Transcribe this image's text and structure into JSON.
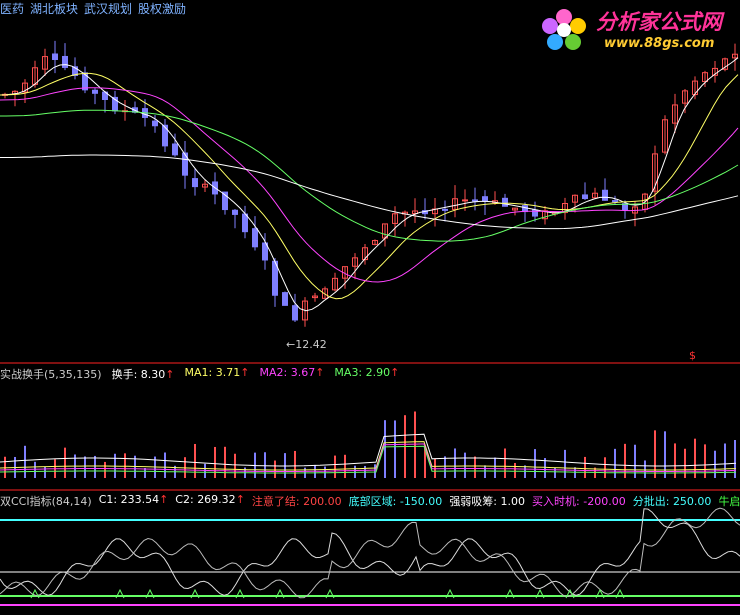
{
  "header": {
    "tags": [
      "医药",
      "湖北板块",
      "武汉规划",
      "股权激励"
    ],
    "tags_color": "#7fb2ff"
  },
  "watermark": {
    "site_name": "分析家公式网",
    "url": "www.88gs.com"
  },
  "price_panel": {
    "low_label": "12.42",
    "marker_symbol": "$"
  },
  "volume_panel": {
    "title": "实战换手(5,35,135)",
    "items": [
      {
        "label": "换手:",
        "value": "8.30",
        "arrow": "↑",
        "color": "#ffffff"
      },
      {
        "label": "MA1:",
        "value": "3.71",
        "arrow": "↑",
        "color": "#ffff66"
      },
      {
        "label": "MA2:",
        "value": "3.67",
        "arrow": "↑",
        "color": "#ff44ff"
      },
      {
        "label": "MA3:",
        "value": "2.90",
        "arrow": "↑",
        "color": "#66ff66"
      }
    ]
  },
  "cci_panel": {
    "title": "双CCI指标(84,14)",
    "items": [
      {
        "label": "C1:",
        "value": "233.54",
        "arrow": "↑",
        "color": "#ffffff"
      },
      {
        "label": "C2:",
        "value": "269.32",
        "arrow": "↑",
        "color": "#ffffff"
      },
      {
        "label": "注意了结:",
        "value": "200.00",
        "arrow": "",
        "color": "#ff4444"
      },
      {
        "label": "底部区域:",
        "value": "-150.00",
        "arrow": "",
        "color": "#44ffff"
      },
      {
        "label": "强弱吸筹:",
        "value": "1.00",
        "arrow": "",
        "color": "#ffffff"
      },
      {
        "label": "买入时机:",
        "value": "-200.00",
        "arrow": "",
        "color": "#ff44ff"
      },
      {
        "label": "分批出:",
        "value": "250.00",
        "arrow": "",
        "color": "#44ffff"
      },
      {
        "label": "牛启",
        "value": "",
        "arrow": "",
        "color": "#44ff44"
      }
    ]
  },
  "colors": {
    "up": "#ff5050",
    "down": "#7f7fff",
    "ma_white": "#ffffff",
    "ma_yellow": "#ffff66",
    "ma_magenta": "#ff44ff",
    "ma_green": "#66ff66",
    "ma_cyan": "#44ffff",
    "separator": "#ff2222"
  },
  "chart_data": {
    "type": "candlestick",
    "price_series_count": 74,
    "moving_averages": [
      "white",
      "yellow",
      "magenta",
      "green",
      "cyan"
    ]
  }
}
